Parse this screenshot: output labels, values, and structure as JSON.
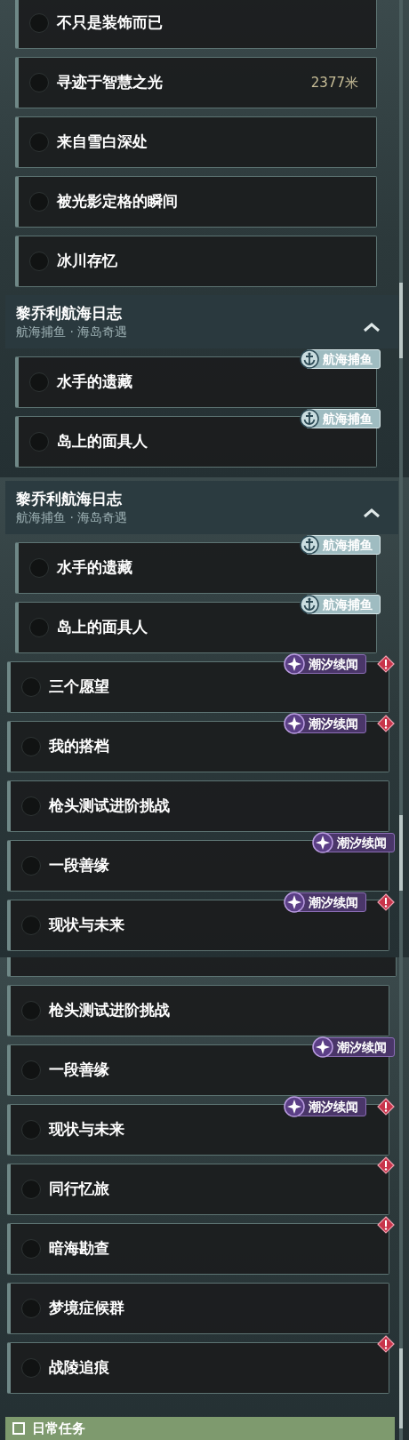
{
  "panels": [
    {
      "entries": [
        {
          "kind": "subtask",
          "title": "不只是装饰而已"
        },
        {
          "kind": "subtask",
          "title": "寻迹于智慧之光",
          "distance": "2377米"
        },
        {
          "kind": "subtask",
          "title": "来自雪白深处"
        },
        {
          "kind": "subtask",
          "title": "被光影定格的瞬间"
        },
        {
          "kind": "subtask",
          "title": "冰川存忆"
        },
        {
          "kind": "header",
          "title": "黎乔利航海日志",
          "subtitle": "航海捕鱼 · 海岛奇遇",
          "expanded": true
        },
        {
          "kind": "subtask",
          "title": "水手的遗藏",
          "tag": {
            "kind": "fishing",
            "label": "航海捕鱼"
          }
        },
        {
          "kind": "subtask",
          "title": "岛上的面具人",
          "tag": {
            "kind": "fishing",
            "label": "航海捕鱼"
          }
        }
      ]
    },
    {
      "entries": [
        {
          "kind": "header",
          "title": "黎乔利航海日志",
          "subtitle": "航海捕鱼 · 海岛奇遇",
          "expanded": true
        },
        {
          "kind": "subtask",
          "title": "水手的遗藏",
          "tag": {
            "kind": "fishing",
            "label": "航海捕鱼"
          }
        },
        {
          "kind": "subtask",
          "title": "岛上的面具人",
          "tag": {
            "kind": "fishing",
            "label": "航海捕鱼"
          }
        },
        {
          "kind": "task",
          "title": "三个愿望",
          "tag": {
            "kind": "tide",
            "label": "潮汐续闻"
          },
          "alert": true
        },
        {
          "kind": "task",
          "title": "我的搭档",
          "tag": {
            "kind": "tide",
            "label": "潮汐续闻"
          },
          "alert": true
        },
        {
          "kind": "task",
          "title": "枪头测试进阶挑战"
        },
        {
          "kind": "task",
          "title": "一段善缘",
          "tag": {
            "kind": "tide",
            "label": "潮汐续闻"
          }
        },
        {
          "kind": "task",
          "title": "现状与未来",
          "tag": {
            "kind": "tide",
            "label": "潮汐续闻"
          },
          "alert": true
        }
      ]
    },
    {
      "entries": [
        {
          "kind": "cut"
        },
        {
          "kind": "task",
          "title": "枪头测试进阶挑战"
        },
        {
          "kind": "task",
          "title": "一段善缘",
          "tag": {
            "kind": "tide",
            "label": "潮汐续闻"
          }
        },
        {
          "kind": "task",
          "title": "现状与未来",
          "tag": {
            "kind": "tide",
            "label": "潮汐续闻"
          },
          "alert": true
        },
        {
          "kind": "task",
          "title": "同行忆旅",
          "alert": true
        },
        {
          "kind": "task",
          "title": "暗海勘查",
          "alert": true
        },
        {
          "kind": "task",
          "title": "梦境症候群"
        },
        {
          "kind": "task",
          "title": "战陵追痕",
          "alert": true
        }
      ],
      "footer": "日常任务"
    }
  ]
}
